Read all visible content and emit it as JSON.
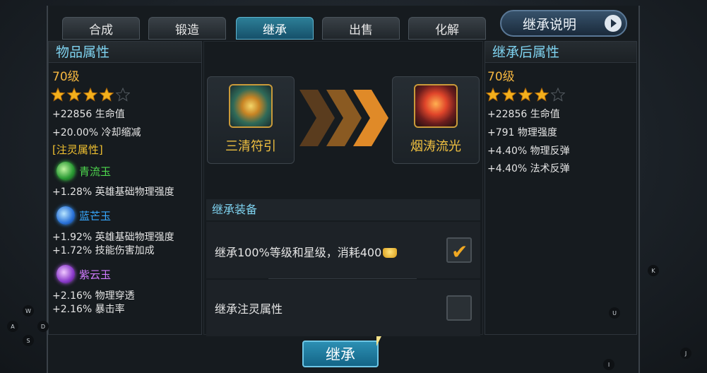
{
  "tabs": [
    {
      "label": "合成"
    },
    {
      "label": "锻造"
    },
    {
      "label": "继承",
      "active": true
    },
    {
      "label": "出售"
    },
    {
      "label": "化解"
    }
  ],
  "help_button": {
    "label": "继承说明",
    "icon": "play-icon"
  },
  "left_panel": {
    "title": "物品属性",
    "level": "70级",
    "stars": 4,
    "max_stars": 5,
    "stats": [
      "+22856 生命值",
      "+20.00% 冷却缩减"
    ],
    "infuse_header": "[注灵属性]",
    "gems": [
      {
        "name": "青流玉",
        "color": "green",
        "stats": [
          "+1.28% 英雄基础物理强度"
        ]
      },
      {
        "name": "蓝芒玉",
        "color": "blue",
        "stats": [
          "+1.92% 英雄基础物理强度",
          "+1.72% 技能伤害加成"
        ]
      },
      {
        "name": "紫云玉",
        "color": "purple",
        "stats": [
          "+2.16% 物理穿透",
          "+2.16% 暴击率"
        ]
      }
    ]
  },
  "source_item": {
    "name": "三清符引"
  },
  "target_item": {
    "name": "烟涛流光"
  },
  "inherit_section": {
    "title": "继承装备",
    "options": [
      {
        "label": "继承100%等级和星级，消耗400",
        "checked": true,
        "currency_icon": "gold-ingot-icon"
      },
      {
        "label": "继承注灵属性",
        "checked": false
      }
    ]
  },
  "right_panel": {
    "title": "继承后属性",
    "level": "70级",
    "stars": 4,
    "max_stars": 5,
    "stats": [
      "+22856 生命值",
      "+791 物理强度",
      "+4.40% 物理反弹",
      "+4.40% 法术反弹"
    ]
  },
  "inherit_button": {
    "label": "继承"
  },
  "key_hints": [
    "W",
    "A",
    "D",
    "S",
    "K",
    "U",
    "J",
    "I"
  ],
  "colors": {
    "accent": "#7fd3f0",
    "gold": "#f4b640",
    "tab_active": "#2d7f97"
  }
}
